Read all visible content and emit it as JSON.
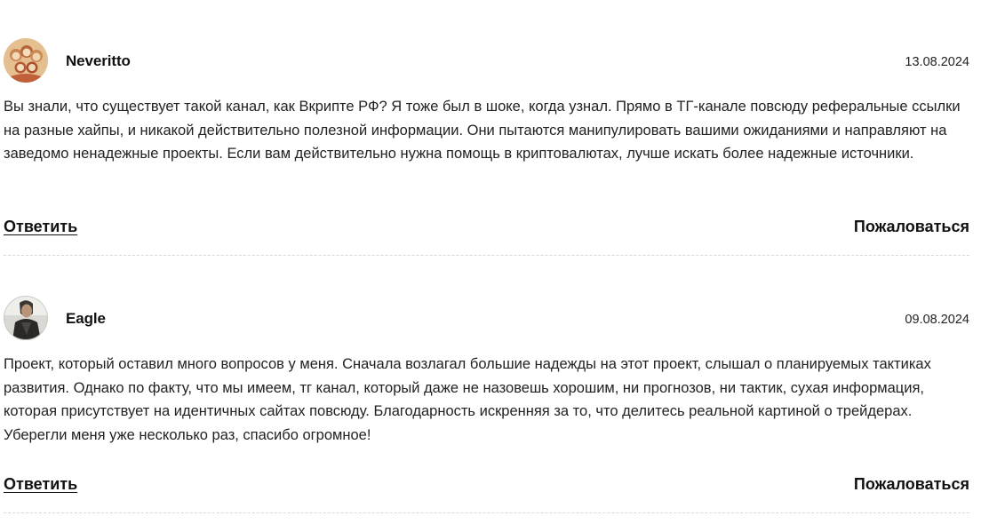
{
  "comments": [
    {
      "author": "Neveritto",
      "date": "13.08.2024",
      "avatar_icon": "group-portrait-avatar",
      "text": "Вы знали, что существует такой канал, как Вкрипте РФ? Я тоже был в шоке, когда узнал. Прямо в ТГ-канале повсюду реферальные ссылки на разные хайпы, и никакой действительно полезной информации. Они пытаются манипулировать вашими ожиданиями и направляют на заведомо ненадежные проекты. Если вам действительно нужна помощь в криптовалютах, лучше искать более надежные источники.",
      "reply_label": "Ответить",
      "report_label": "Пожаловаться"
    },
    {
      "author": "Eagle",
      "date": "09.08.2024",
      "avatar_icon": "person-photo-avatar",
      "text": "Проект, который оставил много вопросов у меня. Сначала возлагал большие надежды на этот проект, слышал о планируемых тактиках развития. Однако по факту, что мы имеем, тг канал, который даже не назовешь хорошим, ни прогнозов, ни тактик, сухая информация, которая присутствует на идентичных сайтах повсюду. Благодарность искренняя за то, что делитесь реальной картиной о трейдерах. Уберегли меня уже несколько раз, спасибо огромное!",
      "reply_label": "Ответить",
      "report_label": "Пожаловаться"
    }
  ]
}
